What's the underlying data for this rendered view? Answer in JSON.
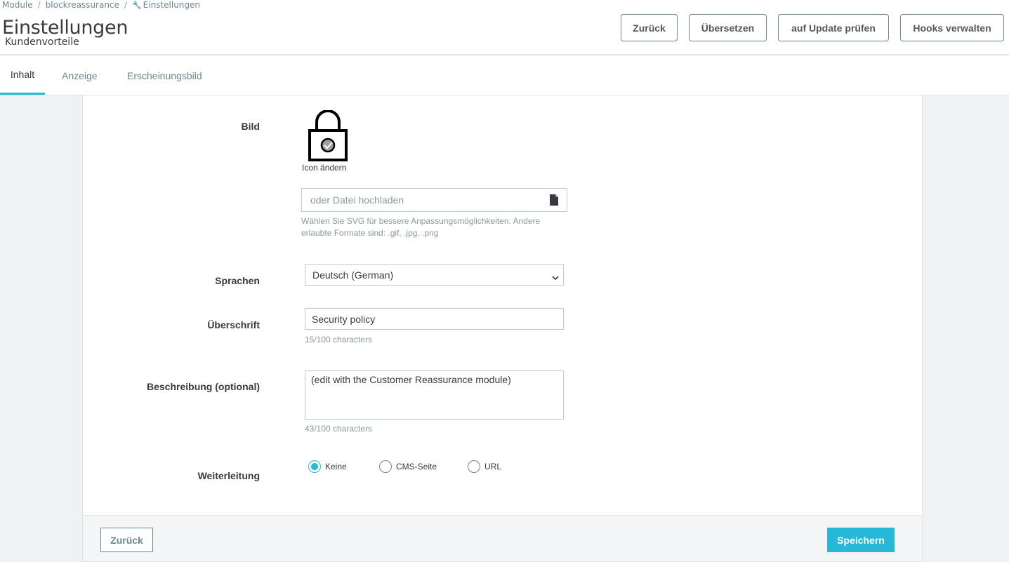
{
  "breadcrumb": {
    "items": [
      "Module",
      "blockreassurance",
      "Einstellungen"
    ],
    "current_icon": "wrench-icon"
  },
  "header": {
    "title": "Einstellungen",
    "subtitle": "Kundenvorteile",
    "buttons": {
      "back": "Zurück",
      "translate": "Übersetzen",
      "check_update": "auf Update prüfen",
      "manage_hooks": "Hooks verwalten"
    }
  },
  "tabs": [
    {
      "label": "Inhalt",
      "active": true
    },
    {
      "label": "Anzeige",
      "active": false
    },
    {
      "label": "Erscheinungsbild",
      "active": false
    }
  ],
  "form": {
    "image": {
      "label": "Bild",
      "icon": "lock-icon",
      "change_icon_label": "Icon ändern",
      "upload_placeholder": "oder Datei hochladen",
      "help": "Wählen Sie SVG für bessere Anpassungsmöglichkeiten. Andere erlaubte Formate sind: .gif, .jpg, .png"
    },
    "languages": {
      "label": "Sprachen",
      "selected": "Deutsch (German)"
    },
    "heading": {
      "label": "Überschrift",
      "value": "Security policy",
      "count": "15/100 characters"
    },
    "description": {
      "label": "Beschreibung (optional)",
      "value": "(edit with the Customer Reassurance module)",
      "count": "43/100 characters"
    },
    "redirect": {
      "label": "Weiterleitung",
      "options": [
        "Keine",
        "CMS-Seite",
        "URL"
      ],
      "selected": "Keine"
    }
  },
  "footer": {
    "back": "Zurück",
    "save": "Speichern"
  },
  "colors": {
    "accent": "#25b9d7",
    "text": "#363a41",
    "muted": "#6c868e"
  }
}
